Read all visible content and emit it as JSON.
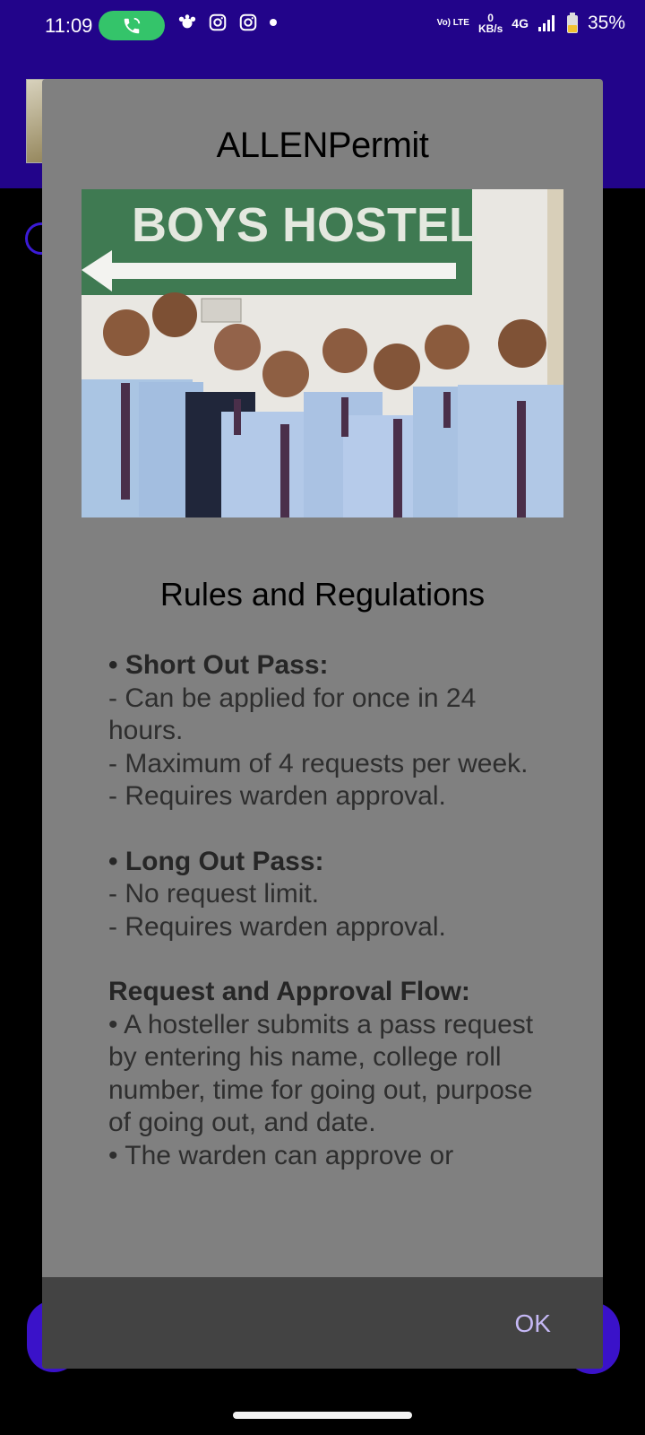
{
  "status_bar": {
    "time": "11:09",
    "lte_label": "Vo) LTE",
    "net_speed_value": "0",
    "net_speed_unit": "KB/s",
    "network": "4G",
    "battery_percent": "35%"
  },
  "dialog": {
    "title": "ALLENPermit",
    "hero_sign_text": "BOYS HOSTEL",
    "rules_heading": "Rules and Regulations",
    "rules": {
      "short_out": {
        "heading": "• Short Out Pass:",
        "lines": [
          "- Can be applied for once in 24 hours.",
          "- Maximum of 4 requests per week.",
          "- Requires warden approval."
        ]
      },
      "long_out": {
        "heading": "• Long Out Pass:",
        "lines": [
          "- No request limit.",
          "- Requires warden approval."
        ]
      },
      "flow": {
        "heading": "Request and Approval Flow:",
        "lines": [
          "• A hosteller submits a pass request by entering his name, college roll number, time for going out, purpose of going out, and date.",
          "• The warden can approve or"
        ]
      }
    },
    "ok_label": "OK"
  },
  "colors": {
    "app_bar": "#22048a",
    "dialog_bg": "#808080",
    "dialog_footer": "#434343",
    "ok_text": "#c5b8f5",
    "call_pill": "#34c46a"
  }
}
